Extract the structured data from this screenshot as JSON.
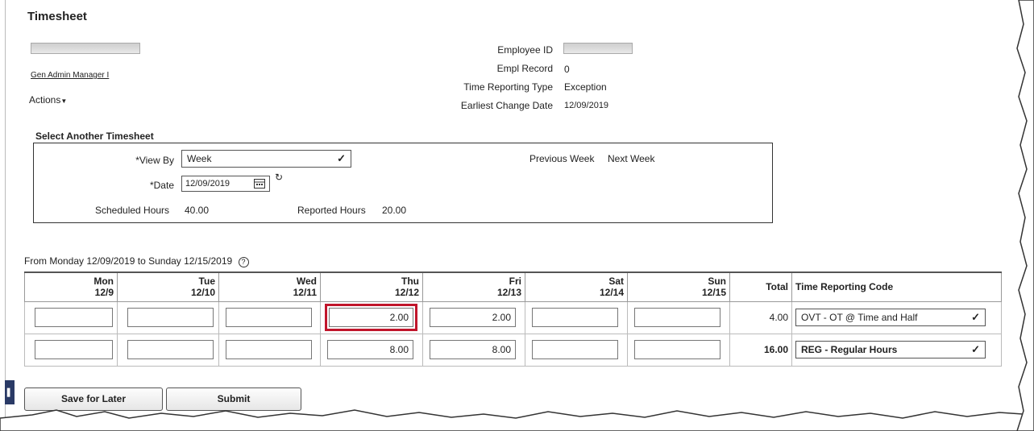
{
  "page": {
    "title": "Timesheet"
  },
  "employee": {
    "job_title": "Gen Admin Manager I",
    "actions_label": "Actions",
    "fields": [
      {
        "label": "Employee ID",
        "value": ""
      },
      {
        "label": "Empl Record",
        "value": "0"
      },
      {
        "label": "Time Reporting Type",
        "value": "Exception"
      },
      {
        "label": "Earliest Change Date",
        "value": "12/09/2019"
      }
    ]
  },
  "select_timesheet": {
    "heading": "Select Another Timesheet",
    "view_by_label": "*View By",
    "view_by_value": "Week",
    "date_label": "*Date",
    "date_value": "12/09/2019",
    "previous_week": "Previous Week",
    "next_week": "Next Week",
    "scheduled_hours_label": "Scheduled Hours",
    "scheduled_hours_value": "40.00",
    "reported_hours_label": "Reported Hours",
    "reported_hours_value": "20.00"
  },
  "range_label": "From Monday 12/09/2019 to Sunday 12/15/2019",
  "grid": {
    "days": [
      {
        "day": "Mon",
        "date": "12/9"
      },
      {
        "day": "Tue",
        "date": "12/10"
      },
      {
        "day": "Wed",
        "date": "12/11"
      },
      {
        "day": "Thu",
        "date": "12/12"
      },
      {
        "day": "Fri",
        "date": "12/13"
      },
      {
        "day": "Sat",
        "date": "12/14"
      },
      {
        "day": "Sun",
        "date": "12/15"
      }
    ],
    "total_header": "Total",
    "trc_header": "Time Reporting Code",
    "rows": [
      {
        "values": [
          "",
          "",
          "",
          "2.00",
          "2.00",
          "",
          ""
        ],
        "total": "4.00",
        "trc": "OVT - OT @ Time and Half"
      },
      {
        "values": [
          "",
          "",
          "",
          "8.00",
          "8.00",
          "",
          ""
        ],
        "total": "16.00",
        "trc": "REG - Regular Hours"
      }
    ]
  },
  "buttons": {
    "save_for_later": "Save for Later",
    "submit": "Submit"
  },
  "colors": {
    "highlight": "#c0152b"
  }
}
